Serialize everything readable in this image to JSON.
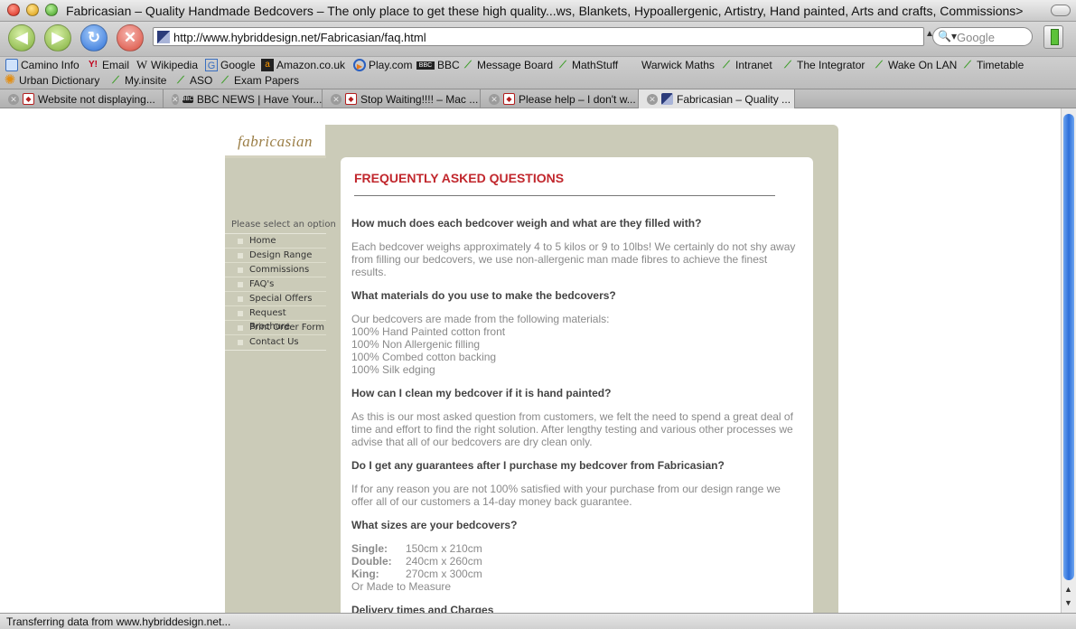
{
  "window": {
    "title": "Fabricasian – Quality Handmade Bedcovers – The only place to get these high quality...ws, Blankets, Hypoallergenic, Artistry, Hand painted, Arts and crafts, Commissions>"
  },
  "toolbar": {
    "url": "http://www.hybriddesign.net/Fabricasian/faq.html",
    "search_placeholder": "Google"
  },
  "bookmarks": [
    {
      "label": "Camino Info",
      "icon": "folder-icon"
    },
    {
      "label": "Email",
      "icon": "yahoo-icon"
    },
    {
      "label": "Wikipedia",
      "icon": "wikipedia-icon"
    },
    {
      "label": "Google",
      "icon": "google-icon"
    },
    {
      "label": "Amazon.co.uk",
      "icon": "amazon-icon"
    },
    {
      "label": "Play.com",
      "icon": "play-icon"
    },
    {
      "label": "BBC",
      "icon": "bbc-icon"
    },
    {
      "label": "Message Board",
      "icon": "leaf-icon"
    },
    {
      "label": "MathStuff",
      "icon": "leaf-icon"
    },
    {
      "label": "Warwick Maths",
      "icon": "none"
    },
    {
      "label": "Intranet",
      "icon": "leaf-icon"
    },
    {
      "label": "The Integrator",
      "icon": "leaf-icon"
    },
    {
      "label": "Wake On LAN",
      "icon": "leaf-icon"
    },
    {
      "label": "Timetable",
      "icon": "leaf-icon"
    },
    {
      "label": "Urban Dictionary",
      "icon": "sun-icon"
    },
    {
      "label": "My.insite",
      "icon": "leaf-icon"
    },
    {
      "label": "ASO",
      "icon": "leaf-icon"
    },
    {
      "label": "Exam Papers",
      "icon": "leaf-icon"
    }
  ],
  "tabs": [
    {
      "label": "Website not displaying...",
      "active": false
    },
    {
      "label": "BBC NEWS | Have Your...",
      "active": false
    },
    {
      "label": "Stop Waiting!!!! – Mac ...",
      "active": false
    },
    {
      "label": "Please help – I don't w...",
      "active": false
    },
    {
      "label": "Fabricasian – Quality ...",
      "active": true
    }
  ],
  "status": "Transferring data from www.hybriddesign.net...",
  "site": {
    "logo": "fabricasian",
    "nav_prompt": "Please select an option",
    "nav": [
      "Home",
      "Design Range",
      "Commissions",
      "FAQ's",
      "Special Offers",
      "Request Brochure",
      "Print Order Form",
      "Contact Us"
    ],
    "heading": "FREQUENTLY ASKED QUESTIONS",
    "faq": [
      {
        "q": "How much does each bedcover weigh and what are they filled with?",
        "a": "Each bedcover weighs approximately 4 to 5 kilos or 9 to 10lbs! We certainly do not shy away from filling our bedcovers, we use non-allergenic man made fibres to achieve the finest results."
      },
      {
        "q": "What materials do you use to make the bedcovers?",
        "a_lines": [
          "Our bedcovers are made from the following materials:",
          "100% Hand Painted cotton front",
          "100% Non Allergenic filling",
          "100% Combed cotton backing",
          "100% Silk edging"
        ]
      },
      {
        "q": "How can I clean my bedcover if it is hand painted?",
        "a": "As this is our most asked question from customers, we felt the need to spend a great deal of time and effort to find the right solution. After lengthy testing and various other processes we advise that all of our bedcovers are dry clean only."
      },
      {
        "q": "Do I get any guarantees after I purchase my bedcover from Fabricasian?",
        "a": "If for any reason you are not 100% satisfied with your purchase from our design range we offer all of our customers a 14-day money back guarantee."
      },
      {
        "q": "What sizes are your bedcovers?",
        "sizes": [
          {
            "label": "Single:",
            "value": "150cm x 210cm"
          },
          {
            "label": "Double:",
            "value": "240cm x 260cm"
          },
          {
            "label": "King:",
            "value": "270cm x 300cm"
          }
        ],
        "extra": "Or Made to Measure"
      },
      {
        "q": "Delivery times and Charges"
      }
    ]
  }
}
